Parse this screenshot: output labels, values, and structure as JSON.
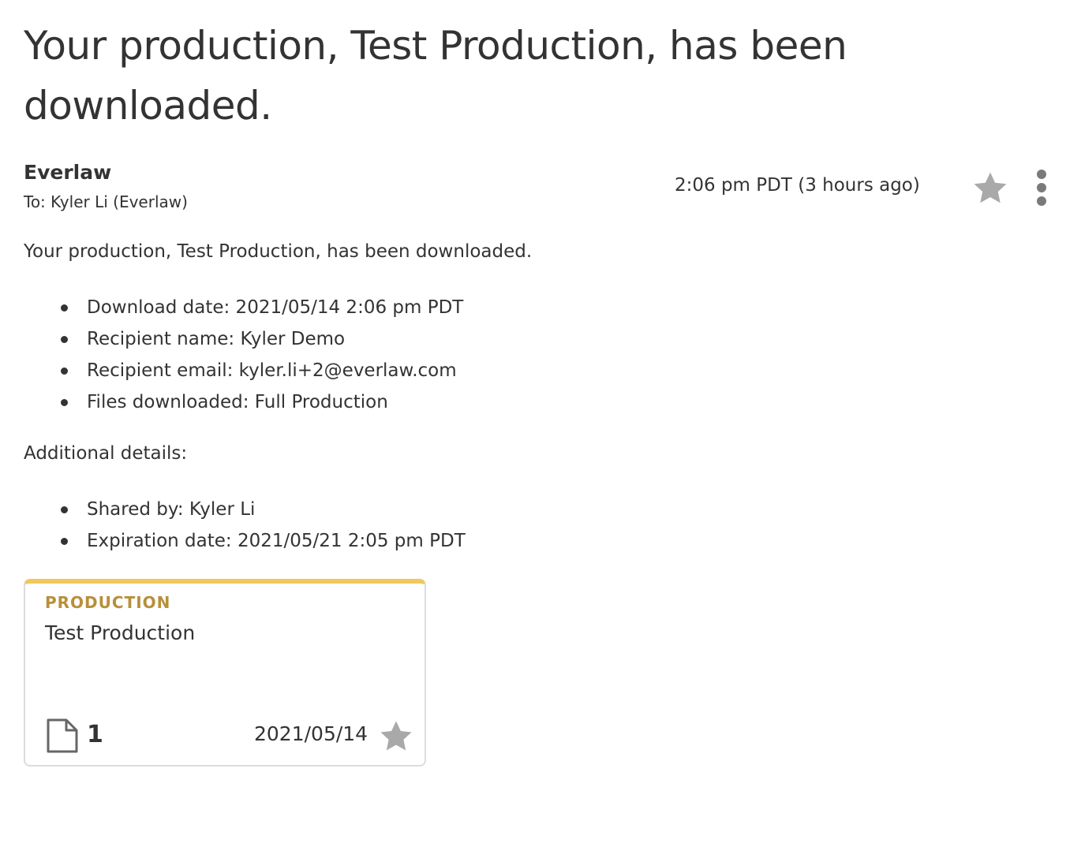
{
  "email": {
    "subject": "Your production, Test Production, has been downloaded.",
    "sender": "Everlaw",
    "recipient": "To: Kyler Li (Everlaw)",
    "timestamp": "2:06 pm PDT (3 hours ago)",
    "intro": "Your production, Test Production, has been downloaded.",
    "details": [
      "Download date: 2021/05/14 2:06 pm PDT",
      "Recipient name: Kyler Demo",
      "Recipient email: kyler.li+2@everlaw.com",
      "Files downloaded: Full Production"
    ],
    "additional_label": "Additional details:",
    "additional": [
      "Shared by: Kyler Li",
      "Expiration date: 2021/05/21 2:05 pm PDT"
    ]
  },
  "card": {
    "type": "PRODUCTION",
    "name": "Test Production",
    "doc_count": "1",
    "date": "2021/05/14"
  },
  "icons": {
    "star": "star-icon",
    "more": "more-vertical-icon",
    "document": "document-icon"
  },
  "colors": {
    "accent": "#f1c75e",
    "card_type": "#b88f3a",
    "icon_gray": "#a9a9a9"
  }
}
